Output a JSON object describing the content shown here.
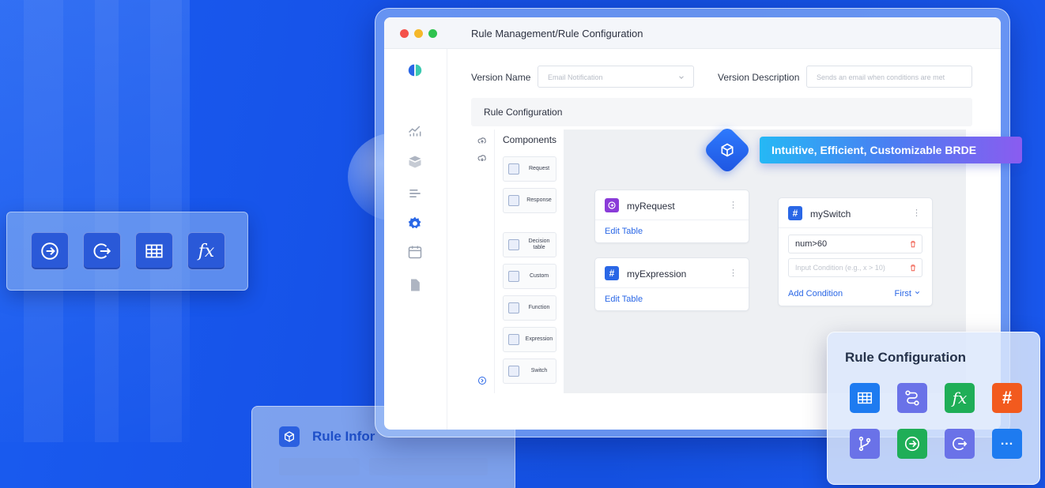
{
  "window": {
    "title": "Rule Management/Rule Configuration"
  },
  "form": {
    "version_name_label": "Version Name",
    "version_name_value": "Email Notification",
    "version_description_label": "Version Description",
    "version_description_placeholder": "Sends an email when conditions are met"
  },
  "config": {
    "header": "Rule Configuration",
    "components_title": "Components",
    "components": [
      {
        "label": "Request",
        "icon": "request-icon"
      },
      {
        "label": "Response",
        "icon": "response-icon"
      },
      {
        "label": "Decision table",
        "icon": "decision-table-icon"
      },
      {
        "label": "Custom",
        "icon": "custom-icon"
      },
      {
        "label": "Function",
        "icon": "function-icon"
      },
      {
        "label": "Expression",
        "icon": "expression-icon"
      },
      {
        "label": "Switch",
        "icon": "switch-icon"
      }
    ]
  },
  "nodes": {
    "request": {
      "name": "myRequest",
      "link": "Edit Table"
    },
    "expression": {
      "name": "myExpression",
      "link": "Edit Table"
    },
    "switch": {
      "name": "mySwitch",
      "condition_1": "num>60",
      "condition_placeholder": "Input Condition (e.g., x > 10)",
      "add_condition": "Add Condition",
      "mode": "First"
    }
  },
  "banner": {
    "text": "Intuitive, Efficient, Customizable BRDE"
  },
  "rule_card": {
    "title": "Rule Configuration"
  },
  "rule_info": {
    "title": "Rule Infor"
  },
  "colors": {
    "background": "#1652e8",
    "accent": "#2a67e6",
    "dot_red": "#f4514b",
    "dot_yellow": "#f5b82a",
    "dot_green": "#2fc34f"
  }
}
